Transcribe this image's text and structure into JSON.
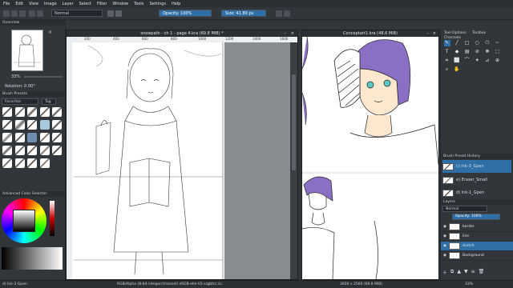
{
  "menu": [
    "File",
    "Edit",
    "View",
    "Image",
    "Layer",
    "Select",
    "Filter",
    "Window",
    "Tools",
    "Settings",
    "Help"
  ],
  "toolbar": {
    "blend_mode": "Normal",
    "opacity_label": "Opacity: 100%",
    "size_label": "Size: 41.80 px"
  },
  "left_docker": {
    "panel_label": "Overview",
    "zoom": "33%",
    "rotation": "Rotation: 0.00°",
    "presets_header": "Brush Presets",
    "favorites": "Favorites",
    "tag_button": "Tag",
    "color_selector": "Advanced Color Selector"
  },
  "doc1": {
    "title": "snowpath - ch 1 - page 4.kra (69.8 MiB) *",
    "ruler_marks": [
      "200",
      "400",
      "600",
      "800",
      "1000",
      "1200",
      "1400",
      "1600"
    ]
  },
  "doc2": {
    "title": "Conceptart1.kra (48.6 MiB)"
  },
  "right_docker": {
    "tabs": [
      "Tool Options",
      "Toolbox",
      "Channels"
    ],
    "history_header": "Brush Preset History",
    "history": [
      "c) Ink-3_Gpen",
      "e) Eraser_Small",
      "d) Ink-1_Gpen"
    ],
    "layers_header": "Layers",
    "blend_mode": "Normal",
    "opacity": "Opacity: 100%",
    "layers": [
      {
        "name": "border",
        "color": "#ffffff"
      },
      {
        "name": "line",
        "color": "#ffffff"
      },
      {
        "name": "sketch",
        "color": "#ffffff"
      },
      {
        "name": "Background",
        "color": "#ffffff"
      }
    ]
  },
  "status": {
    "brush": "d) Ink-3 Gpen",
    "color_profile": "RGB/Alpha (8-bit integer/channel)  sRGB-elle-V2-srgbtrc.icc",
    "dimensions": "3600 x 2560 (69.8 MiB)",
    "zoom": "33%"
  },
  "colors": {
    "accent": "#2d6fa6",
    "hair": "#8a6fc4",
    "skin": "#fde7cf",
    "eye": "#5cc7c4"
  },
  "icons": [
    "brush-icon",
    "eraser-icon",
    "rect-icon",
    "ellipse-icon",
    "line-icon",
    "fill-icon",
    "gradient-icon",
    "picker-icon",
    "move-icon",
    "transform-icon",
    "crop-icon",
    "select-icon",
    "zoom-icon",
    "pan-icon",
    "text-icon",
    "eye-icon",
    "lock-icon",
    "add-icon",
    "delete-icon",
    "close-icon"
  ]
}
